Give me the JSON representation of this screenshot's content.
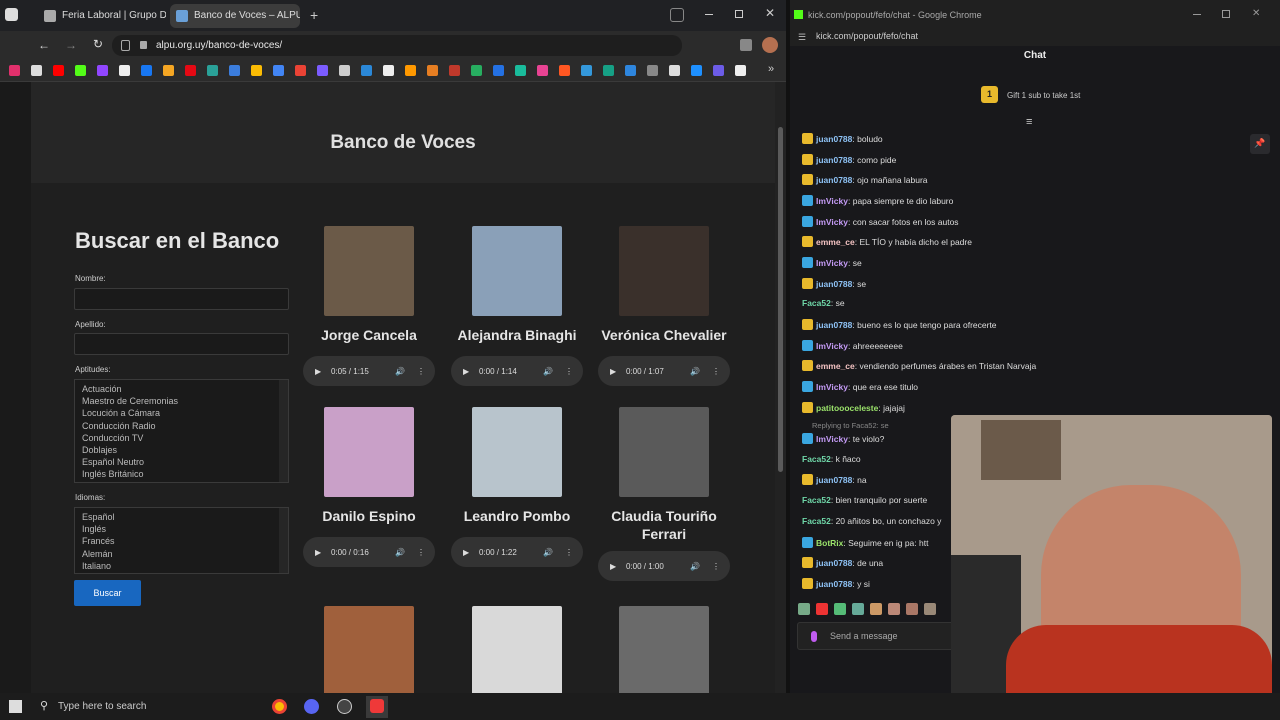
{
  "browser": {
    "tabs": [
      {
        "label": "Feria Laboral | Grupo De Na",
        "active": false
      },
      {
        "label": "Banco de Voces – ALPU",
        "active": true
      }
    ],
    "url": "alpu.org.uy/banco-de-voces/",
    "new_tab": "+"
  },
  "page": {
    "hero_title": "Banco de Voces",
    "search_heading": "Buscar en el Banco",
    "nombre_label": "Nombre:",
    "apellido_label": "Apellido:",
    "aptitudes_label": "Aptitudes:",
    "aptitudes": [
      "Actuación",
      "Maestro de Ceremonias",
      "Locución a Cámara",
      "Conducción Radio",
      "Conducción TV",
      "Doblajes",
      "Español Neutro",
      "Inglés Británico"
    ],
    "idiomas_label": "Idiomas:",
    "idiomas": [
      "Español",
      "Inglés",
      "Francés",
      "Alemán",
      "Italiano"
    ],
    "search_button": "Buscar",
    "voices": [
      {
        "name": "Jorge Cancela",
        "time": "0:05 / 1:15",
        "photo_color": "#6b5a48"
      },
      {
        "name": "Alejandra Binaghi",
        "time": "0:00 / 1:14",
        "photo_color": "#8aa0b8"
      },
      {
        "name": "Verónica Chevalier",
        "time": "0:00 / 1:07",
        "photo_color": "#3a302b"
      },
      {
        "name": "Danilo Espino",
        "time": "0:00 / 0:16",
        "photo_color": "#c9a0c8"
      },
      {
        "name": "Leandro Pombo",
        "time": "0:00 / 1:22",
        "photo_color": "#b8c4cc"
      },
      {
        "name": "Claudia Touriño Ferrari",
        "time": "0:00 / 1:00",
        "photo_color": "#5a5a5a"
      },
      {
        "name": "",
        "time": "",
        "photo_color": "#a0603c"
      },
      {
        "name": "",
        "time": "",
        "photo_color": "#d9d9d9"
      },
      {
        "name": "",
        "time": "",
        "photo_color": "#6a6a6a"
      }
    ]
  },
  "taskbar": {
    "search_placeholder": "Type here to search"
  },
  "chat": {
    "window_title": "kick.com/popout/fefo/chat - Google Chrome",
    "url": "kick.com/popout/fefo/chat",
    "heading": "Chat",
    "gift": "Gift 1 sub to take 1st",
    "gift_count": "1",
    "messages": [
      {
        "user": "juan0788",
        "text": "boludo",
        "color": "#8ec2f5",
        "badge": "#e8b92c"
      },
      {
        "user": "juan0788",
        "text": "como pide",
        "color": "#8ec2f5",
        "badge": "#e8b92c"
      },
      {
        "user": "juan0788",
        "text": "ojo mañana labura",
        "color": "#8ec2f5",
        "badge": "#e8b92c"
      },
      {
        "user": "ImVicky",
        "text": "papa siempre te dio laburo",
        "color": "#c49bf5",
        "badge": "#3aa6e0"
      },
      {
        "user": "ImVicky",
        "text": "con sacar fotos en los autos",
        "color": "#c49bf5",
        "badge": "#3aa6e0"
      },
      {
        "user": "emme_ce",
        "text": "EL TÍO y había dicho el padre",
        "color": "#f5c4c4",
        "badge": "#e8b92c"
      },
      {
        "user": "ImVicky",
        "text": "se",
        "color": "#c49bf5",
        "badge": "#3aa6e0"
      },
      {
        "user": "juan0788",
        "text": "se",
        "color": "#8ec2f5",
        "badge": "#e8b92c"
      },
      {
        "user": "Faca52",
        "text": "se",
        "color": "#6fd6a8",
        "badge": ""
      },
      {
        "user": "juan0788",
        "text": "bueno es lo que tengo para ofrecerte",
        "color": "#8ec2f5",
        "badge": "#e8b92c"
      },
      {
        "user": "ImVicky",
        "text": "ahreeeeeeee",
        "color": "#c49bf5",
        "badge": "#3aa6e0"
      },
      {
        "user": "emme_ce",
        "text": "vendiendo perfumes árabes en Tristan Narvaja",
        "color": "#f5c4c4",
        "badge": "#e8b92c"
      },
      {
        "user": "ImVicky",
        "text": "que era ese titulo",
        "color": "#c49bf5",
        "badge": "#3aa6e0"
      },
      {
        "user": "patitoooceleste",
        "text": "jajajaj",
        "color": "#9be36b",
        "badge": "#e8b92c"
      },
      {
        "user": "ImVicky",
        "text": "te violo?",
        "color": "#c49bf5",
        "badge": "#3aa6e0"
      },
      {
        "user": "Faca52",
        "text": "k ñaco",
        "color": "#6fd6a8",
        "badge": ""
      },
      {
        "user": "juan0788",
        "text": "na",
        "color": "#8ec2f5",
        "badge": "#e8b92c"
      },
      {
        "user": "Faca52",
        "text": "bien tranquilo por suerte",
        "color": "#6fd6a8",
        "badge": ""
      },
      {
        "user": "Faca52",
        "text": "20 añitos bo, un conchazo y",
        "color": "#6fd6a8",
        "badge": ""
      },
      {
        "user": "BotRix",
        "text": "Seguime en ig pa: htt",
        "color": "#9be36b",
        "badge": "#3aa6e0"
      },
      {
        "user": "juan0788",
        "text": "de una",
        "color": "#8ec2f5",
        "badge": "#e8b92c"
      },
      {
        "user": "juan0788",
        "text": "y si",
        "color": "#8ec2f5",
        "badge": "#e8b92c"
      }
    ],
    "reply_note": "Replying to Faca52: se",
    "input_placeholder": "Send a message"
  }
}
